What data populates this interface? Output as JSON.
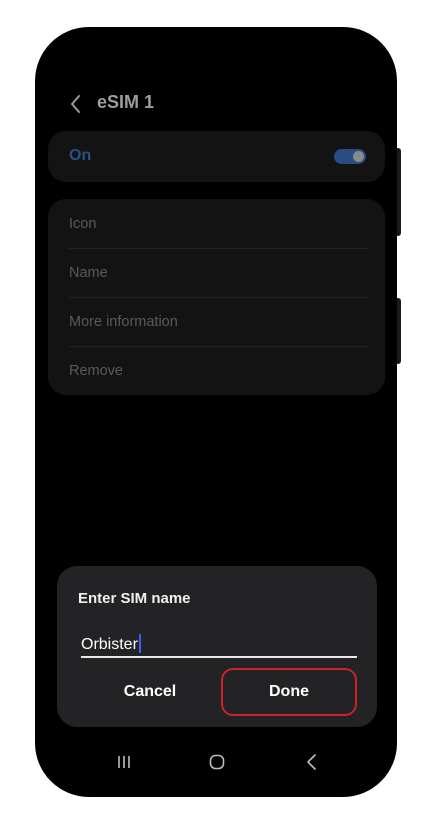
{
  "screen": {
    "title": "eSIM 1",
    "toggle": {
      "label": "On",
      "state": "on"
    },
    "options": [
      {
        "label": "Icon"
      },
      {
        "label": "Name"
      },
      {
        "label": "More information"
      },
      {
        "label": "Remove"
      }
    ]
  },
  "dialog": {
    "title": "Enter SIM name",
    "input_value": "Orbister",
    "cancel_label": "Cancel",
    "done_label": "Done"
  },
  "navbar": {
    "icons": [
      "recent-apps-icon",
      "home-icon",
      "back-icon"
    ]
  },
  "colors": {
    "accent": "#2a4b83",
    "highlight": "#cc2229",
    "caret": "#3c5cff"
  }
}
